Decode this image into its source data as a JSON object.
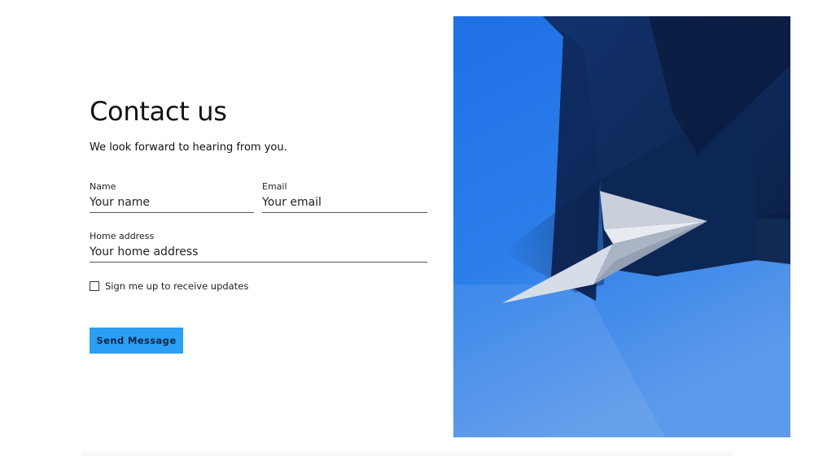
{
  "contact": {
    "title": "Contact us",
    "subtitle": "We look forward to hearing from you."
  },
  "form": {
    "name": {
      "label": "Name",
      "placeholder": "Your name",
      "value": ""
    },
    "email": {
      "label": "Email",
      "placeholder": "Your email",
      "value": ""
    },
    "address": {
      "label": "Home address",
      "placeholder": "Your home address",
      "value": ""
    },
    "updates_checkbox": {
      "label": "Sign me up to receive updates",
      "checked": false
    },
    "submit_label": "Send Message"
  },
  "hero_image": {
    "subject": "paper-plane",
    "colors": {
      "blue": "#2b7fe8",
      "navy": "#0c2550",
      "plane": "#e6eaf0"
    }
  },
  "theme": {
    "button_bg": "#2a9ff5",
    "text": "#1a1a1a"
  }
}
